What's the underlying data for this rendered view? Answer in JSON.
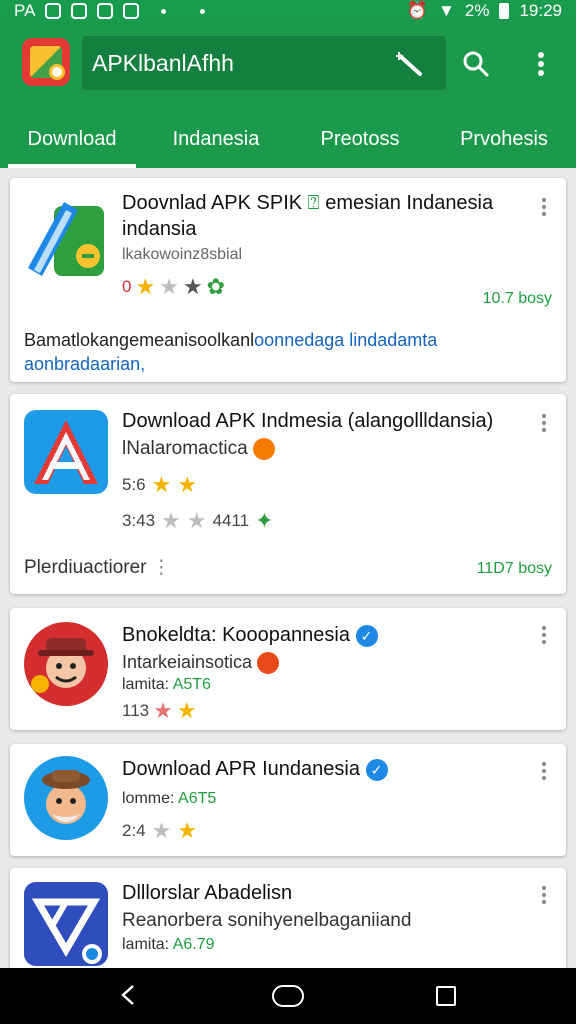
{
  "status_bar": {
    "left_text": "PA",
    "battery_text": "2%",
    "time": "19:29"
  },
  "app_bar": {
    "search_text": "APKlbanlAfhh",
    "icons": [
      "app-logo-icon",
      "magic-wand-icon",
      "search-icon",
      "more-vert-icon"
    ]
  },
  "tabs": [
    {
      "label": "Download",
      "active": true
    },
    {
      "label": "Indanesia",
      "active": false
    },
    {
      "label": "Preotoss",
      "active": false
    },
    {
      "label": "Prvohesis",
      "active": false
    }
  ],
  "cards": [
    {
      "title_line1": "Doovnlad APK SPIK",
      "title_line1_tail": "emesian Indanesia",
      "title_line2": "indansia",
      "subtitle": "lkakowoinz8sbial",
      "rating_text": "0",
      "size": "10.7 bosy",
      "description_part1": "Bamatlokangemeanisoolkanl",
      "description_part2": "oonnedaga lindadamta",
      "description_part3": "aonbradaarian,"
    },
    {
      "title": "Download APK Indmesia (alangollldansia)",
      "subtitle": "lNalaromactica",
      "rating_top": "5:6",
      "rating_bottom_left": "3:43",
      "rating_bottom_right": "4411",
      "footer_label": "Plerdiuactiorer",
      "size": "11D7 bosy"
    },
    {
      "title": "Bnokeldta: Kooopannesia",
      "subtitle": "Intarkeiainsotica",
      "meta_label": "lamita:",
      "meta_value": "A5T6",
      "rating_text": "113"
    },
    {
      "title": "Download APR Iundanesia",
      "meta_label": "lomme:",
      "meta_value": "A6T5",
      "rating_text": "2:4"
    },
    {
      "title": "Dlllorslar Abadelisn",
      "subtitle": "Reanorbera sonihyenelbaganiiand",
      "meta_label": "lamita:",
      "meta_value": "A6.79"
    }
  ],
  "colors": {
    "brand_green": "#1b9a4c",
    "search_bg": "#13803f",
    "accent_green": "#1e9e3e",
    "verified_blue": "#1e88e5",
    "star_yellow": "#f4b400"
  }
}
